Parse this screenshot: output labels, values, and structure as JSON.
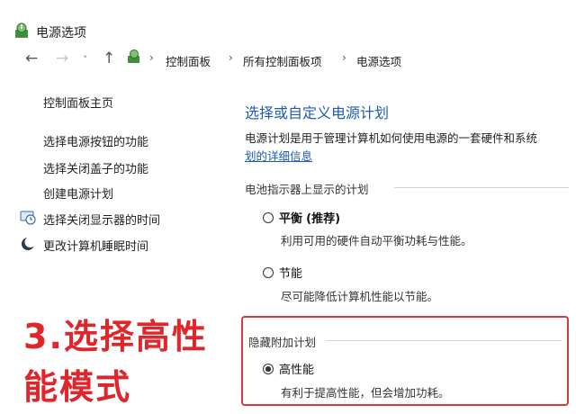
{
  "window": {
    "title": "电源选项",
    "icon": "power-options-icon"
  },
  "nav": {
    "back": "←",
    "forward": "→",
    "recent": "˅",
    "up": "↑",
    "separator": "›",
    "breadcrumbs": [
      "控制面板",
      "所有控制面板项",
      "电源选项"
    ]
  },
  "sidebar": {
    "home": "控制面板主页",
    "items": [
      {
        "label": "选择电源按钮的功能",
        "icon": ""
      },
      {
        "label": "选择关闭盖子的功能",
        "icon": ""
      },
      {
        "label": "创建电源计划",
        "icon": ""
      },
      {
        "label": "选择关闭显示器的时间",
        "icon": "display-time-icon"
      },
      {
        "label": "更改计算机睡眠时间",
        "icon": "sleep-icon"
      }
    ]
  },
  "main": {
    "heading": "选择或自定义电源计划",
    "description": "电源计划是用于管理计算机如何使用电源的一套硬件和系统",
    "description_link": "划的详细信息",
    "battery_group": {
      "label": "电池指示器上显示的计划",
      "plans": [
        {
          "name": "平衡",
          "tag": "(推荐)",
          "desc": "利用可用的硬件自动平衡功耗与性能。",
          "selected": false
        },
        {
          "name": "节能",
          "tag": "",
          "desc": "尽可能降低计算机性能以节能。",
          "selected": false
        }
      ]
    },
    "hidden_group": {
      "label": "隐藏附加计划",
      "plans": [
        {
          "name": "高性能",
          "tag": "",
          "desc": "有利于提高性能，但会增加功耗。",
          "selected": true
        }
      ]
    }
  },
  "annotation": {
    "line1": "3.选择高性",
    "line2": "能模式",
    "color": "#e0262a"
  }
}
